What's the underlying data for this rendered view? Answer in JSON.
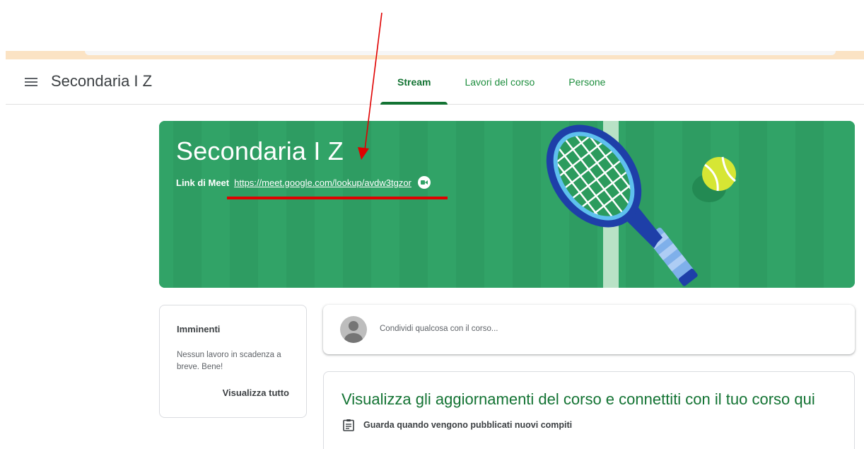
{
  "header": {
    "course_name": "Secondaria I Z",
    "tabs": [
      {
        "label": "Stream",
        "active": true
      },
      {
        "label": "Lavori del corso",
        "active": false
      },
      {
        "label": "Persone",
        "active": false
      }
    ]
  },
  "banner": {
    "title": "Secondaria I Z",
    "meet_label": "Link di Meet",
    "meet_link": "https://meet.google.com/lookup/avdw3tgzor",
    "color": "#31a367",
    "illustration": "tennis-racket-and-ball"
  },
  "upcoming": {
    "title": "Imminenti",
    "text": "Nessun lavoro in scadenza a breve. Bene!",
    "link": "Visualizza tutto"
  },
  "share": {
    "placeholder": "Condividi qualcosa con il corso..."
  },
  "info": {
    "title": "Visualizza gli aggiornamenti del corso e connettiti con il tuo corso qui",
    "item": "Guarda quando vengono pubblicati nuovi compiti",
    "item_icon": "assignment-icon"
  },
  "colors": {
    "accent": "#137333",
    "annotation": "#e00000"
  }
}
